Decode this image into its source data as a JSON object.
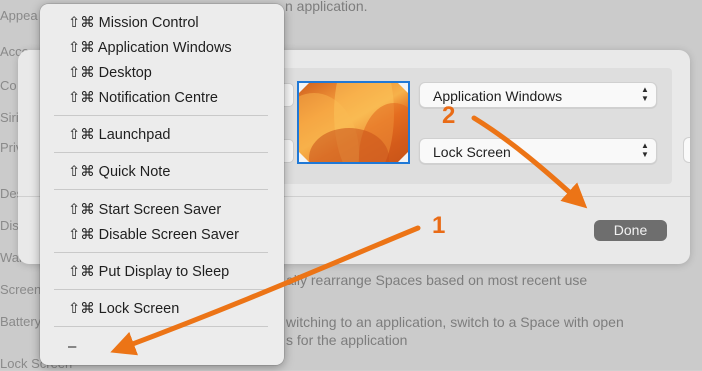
{
  "background": {
    "top_text": "n application.",
    "sidebar_fragments": [
      "Appea",
      "Acce",
      "Co",
      "Siri",
      "Priv",
      "Des",
      "Disp",
      "Wal",
      "Screen",
      "Battery",
      "Lock Screen"
    ],
    "rearrange_text": "ally rearrange Spaces based on most recent use",
    "switch_text_line1": "witching to an application, switch to a Space with open",
    "switch_text_line2": "s for the application"
  },
  "hot_corners": {
    "top_right_select": "Application Windows",
    "bottom_right_select": "Lock Screen",
    "done_label": "Done"
  },
  "context_menu": {
    "items": [
      "⇧⌘ Mission Control",
      "⇧⌘ Application Windows",
      "⇧⌘ Desktop",
      "⇧⌘ Notification Centre",
      "⇧⌘ Launchpad",
      "⇧⌘ Quick Note",
      "⇧⌘ Start Screen Saver",
      "⇧⌘ Disable Screen Saver",
      "⇧⌘ Put Display to Sleep",
      "⇧⌘ Lock Screen",
      "–"
    ]
  },
  "annotations": {
    "callout_1": "1",
    "callout_2": "2",
    "arrow_color": "#ec7416"
  },
  "icons": {
    "popup_chevron_up": "▲",
    "popup_chevron_down": "▼",
    "thumbnail": "desktop-wallpaper-thumbnail"
  }
}
